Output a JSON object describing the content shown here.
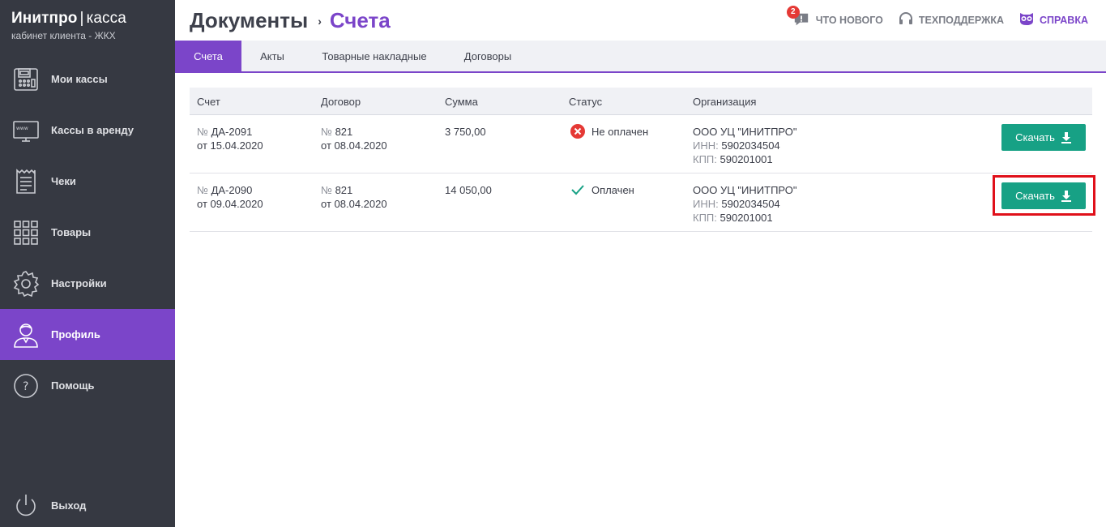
{
  "brand": {
    "name": "Инитпро",
    "separator": "|",
    "product": "касса",
    "subtitle": "кабинет клиента - ЖКХ"
  },
  "sidebar": {
    "items": [
      {
        "label": "Мои кассы",
        "icon": "cash-register-icon",
        "active": false
      },
      {
        "label": "Кассы в аренду",
        "icon": "www-monitor-icon",
        "active": false
      },
      {
        "label": "Чеки",
        "icon": "receipt-icon",
        "active": false
      },
      {
        "label": "Товары",
        "icon": "grid-icon",
        "active": false
      },
      {
        "label": "Настройки",
        "icon": "gear-icon",
        "active": false
      },
      {
        "label": "Профиль",
        "icon": "user-icon",
        "active": true
      },
      {
        "label": "Помощь",
        "icon": "question-circle-icon",
        "active": false
      }
    ],
    "logout": {
      "label": "Выход",
      "icon": "power-icon"
    }
  },
  "header": {
    "breadcrumb_root": "Документы",
    "breadcrumb_arrow": "›",
    "breadcrumb_current": "Счета",
    "news": {
      "label": "Что нового",
      "badge": "2",
      "icon": "chat-icon"
    },
    "support": {
      "label": "Техподдержка",
      "icon": "headset-icon"
    },
    "help": {
      "label": "Справка",
      "icon": "owl-icon"
    }
  },
  "tabs": [
    {
      "label": "Счета",
      "active": true
    },
    {
      "label": "Акты",
      "active": false
    },
    {
      "label": "Товарные накладные",
      "active": false
    },
    {
      "label": "Договоры",
      "active": false
    }
  ],
  "table": {
    "columns": [
      "Счет",
      "Договор",
      "Сумма",
      "Статус",
      "Организация"
    ],
    "rows": [
      {
        "invoice_prefix": "№",
        "invoice_no": "ДА-2091",
        "invoice_date_prefix": "от",
        "invoice_date": "15.04.2020",
        "contract_prefix": "№",
        "contract_no": "821",
        "contract_date_prefix": "от",
        "contract_date": "08.04.2020",
        "amount": "3 750,00",
        "status": "Не оплачен",
        "status_icon": "error-circle-icon",
        "org_name": "ООО УЦ \"ИНИТПРО\"",
        "inn_label": "ИНН:",
        "inn": "5902034504",
        "kpp_label": "КПП:",
        "kpp": "590201001",
        "button_label": "Скачать"
      },
      {
        "invoice_prefix": "№",
        "invoice_no": "ДА-2090",
        "invoice_date_prefix": "от",
        "invoice_date": "09.04.2020",
        "contract_prefix": "№",
        "contract_no": "821",
        "contract_date_prefix": "от",
        "contract_date": "08.04.2020",
        "amount": "14 050,00",
        "status": "Оплачен",
        "status_icon": "checkmark-icon",
        "org_name": "ООО УЦ \"ИНИТПРО\"",
        "inn_label": "ИНН:",
        "inn": "5902034504",
        "kpp_label": "КПП:",
        "kpp": "590201001",
        "button_label": "Скачать"
      }
    ]
  },
  "colors": {
    "accent": "#7b45c9",
    "sidebar": "#363942",
    "button": "#17a185",
    "error": "#e53935",
    "success": "#17a185",
    "highlight": "#e0101a"
  }
}
